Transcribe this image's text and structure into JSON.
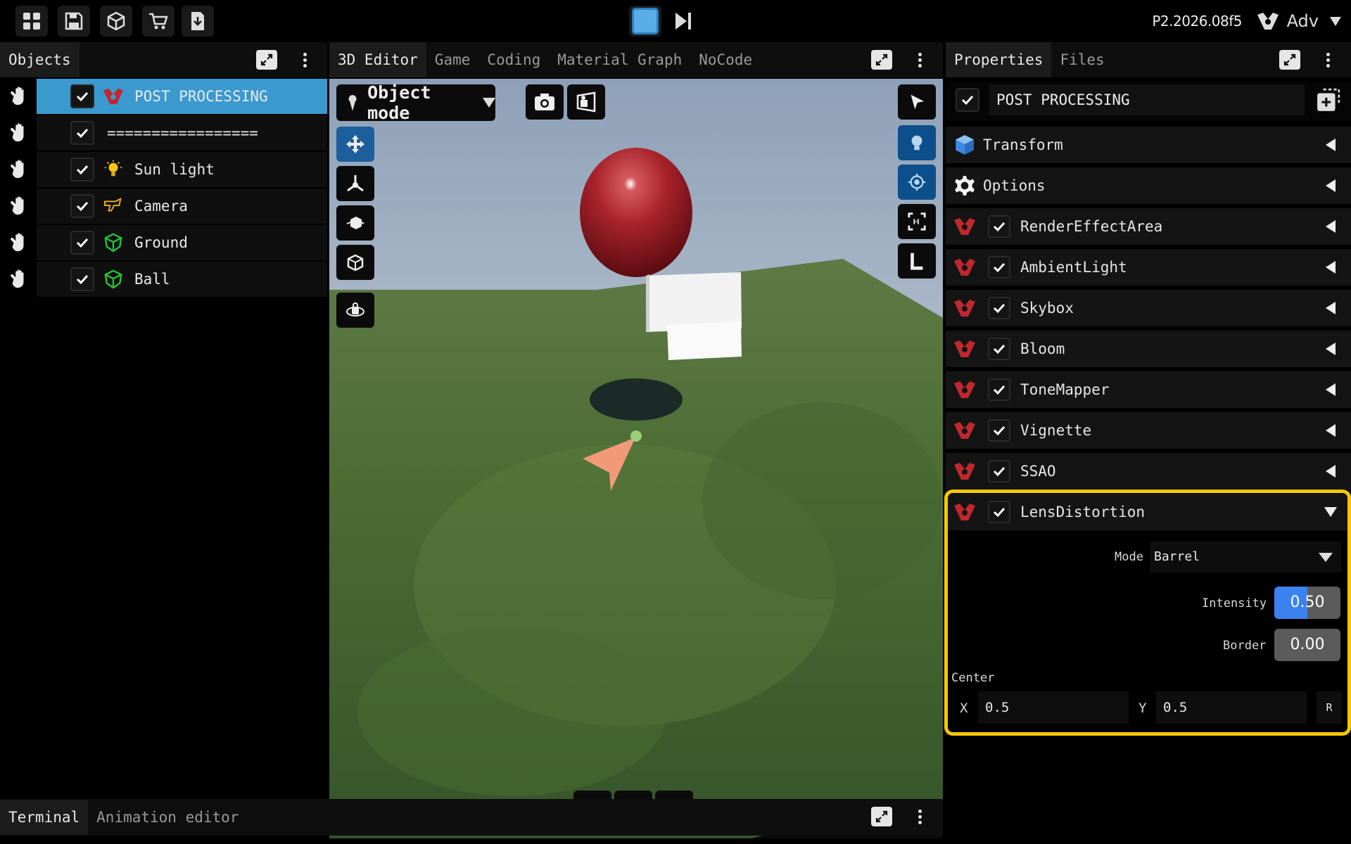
{
  "topbar": {
    "version": "P2.2026.08f5",
    "profile": "Adv"
  },
  "objects_panel": {
    "tab": "Objects",
    "items": [
      {
        "label": "POST PROCESSING",
        "icon": "post-processing-icon",
        "selected": true
      },
      {
        "label": "=================",
        "icon": "",
        "selected": false
      },
      {
        "label": "Sun light",
        "icon": "light-bulb-icon",
        "selected": false
      },
      {
        "label": "Camera",
        "icon": "camera-icon",
        "selected": false
      },
      {
        "label": "Ground",
        "icon": "mesh-icon",
        "selected": false
      },
      {
        "label": "Ball",
        "icon": "mesh-icon",
        "selected": false
      }
    ]
  },
  "editor": {
    "tabs": [
      "3D Editor",
      "Game",
      "Coding",
      "Material Graph",
      "NoCode"
    ],
    "mode": "Object mode"
  },
  "bottom_panel": {
    "tabs": [
      "Terminal",
      "Animation editor"
    ]
  },
  "properties": {
    "tabs": [
      "Properties",
      "Files"
    ],
    "object_name": "POST PROCESSING",
    "sections": [
      {
        "label": "Transform",
        "icon": "cube-icon"
      },
      {
        "label": "Options",
        "icon": "gear-icon"
      }
    ],
    "components": [
      {
        "label": "RenderEffectArea"
      },
      {
        "label": "AmbientLight"
      },
      {
        "label": "Skybox"
      },
      {
        "label": "Bloom"
      },
      {
        "label": "ToneMapper"
      },
      {
        "label": "Vignette"
      },
      {
        "label": "SSAO"
      },
      {
        "label": "LensDistortion",
        "expanded": true
      }
    ],
    "lens": {
      "mode_label": "Mode",
      "mode_value": "Barrel",
      "intensity_label": "Intensity",
      "intensity_value": "0.50",
      "intensity_fraction": 0.5,
      "border_label": "Border",
      "border_value": "0.00",
      "center_label": "Center",
      "x_label": "X",
      "x_value": "0.5",
      "y_label": "Y",
      "y_value": "0.5",
      "reset_label": "R"
    }
  },
  "colors": {
    "accent_blue": "#3a9ad0",
    "highlight_yellow": "#f5c800",
    "icon_red": "#c0282e",
    "mesh_green": "#22c833"
  }
}
